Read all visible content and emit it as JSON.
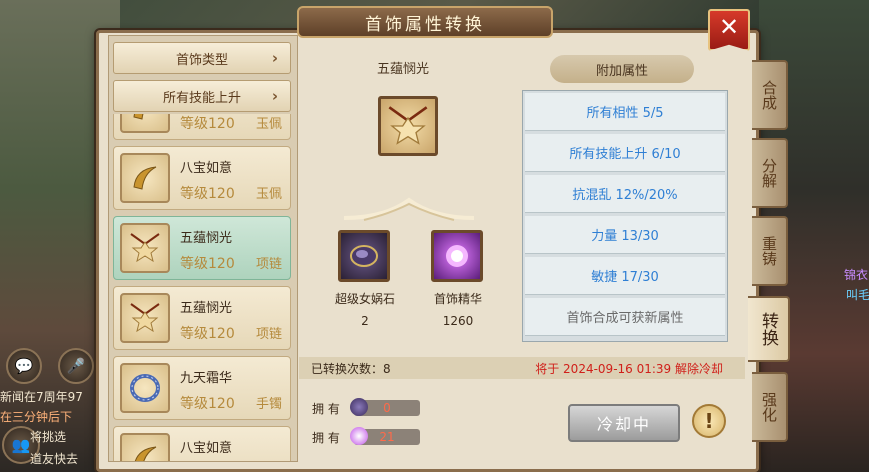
{
  "window": {
    "title": "首饰属性转换",
    "close_label": "✕"
  },
  "filters": {
    "type_label": "首饰类型",
    "skill_label": "所有技能上升",
    "chevron": "›"
  },
  "items": [
    {
      "name": "",
      "level": "等级120",
      "type": "玉佩",
      "icon": "crescent-icon",
      "selected": false
    },
    {
      "name": "八宝如意",
      "level": "等级120",
      "type": "玉佩",
      "icon": "crescent-icon",
      "selected": false
    },
    {
      "name": "五蕴悯光",
      "level": "等级120",
      "type": "项链",
      "icon": "pendant-icon",
      "selected": true
    },
    {
      "name": "五蕴悯光",
      "level": "等级120",
      "type": "项链",
      "icon": "pendant-icon",
      "selected": false
    },
    {
      "name": "九天霜华",
      "level": "等级120",
      "type": "手镯",
      "icon": "bracelet-icon",
      "selected": false
    },
    {
      "name": "八宝如意",
      "level": "",
      "type": "",
      "icon": "crescent-icon",
      "selected": false
    }
  ],
  "selected_item": {
    "name": "五蕴悯光",
    "icon": "pendant-icon"
  },
  "materials": [
    {
      "name": "超级女娲石",
      "count": "2",
      "icon": "stone-icon"
    },
    {
      "name": "首饰精华",
      "count": "1260",
      "icon": "essence-icon"
    }
  ],
  "attributes": {
    "header": "附加属性",
    "rows": [
      "所有相性 5/5",
      "所有技能上升 6/10",
      "抗混乱 12%/20%",
      "力量 13/30",
      "敏捷 17/30"
    ],
    "note": "首饰合成可获新属性"
  },
  "status": {
    "count_text": "已转换次数：8",
    "cooldown_text": "将于 2024-09-16 01:39 解除冷却"
  },
  "owned": [
    {
      "label": "拥 有",
      "value": "0",
      "icon": "stone-icon",
      "color": "#ff6a4a"
    },
    {
      "label": "拥 有",
      "value": "21",
      "icon": "essence-icon",
      "color": "#ff6a4a"
    }
  ],
  "actions": {
    "cooldown_label": "冷却中",
    "info_label": "!"
  },
  "tabs": [
    {
      "label": "合成",
      "active": false
    },
    {
      "label": "分解",
      "active": false
    },
    {
      "label": "重铸",
      "active": false
    },
    {
      "label": "转换",
      "active": true
    },
    {
      "label": "强化",
      "active": false
    }
  ],
  "background": {
    "chat_lines": [
      "新闻在7周年97",
      "在三分钟后下",
      "将挑选",
      "道友快去"
    ],
    "right_text": [
      "锦衣",
      "叫毛"
    ],
    "chat_icon": "chat-icon",
    "voice_icon": "mic-icon",
    "friends_icon": "friends-icon"
  },
  "colors": {
    "accent_blue": "#2f7fd4",
    "warning_red": "#d0201a",
    "selected_green": "#aed3bd"
  }
}
